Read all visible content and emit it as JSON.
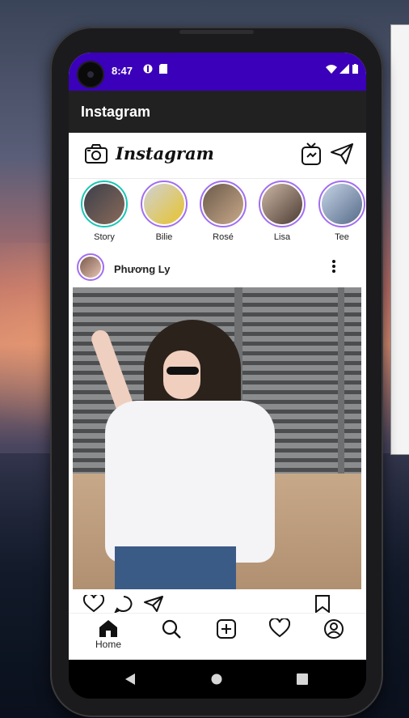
{
  "status_bar": {
    "time": "8:47"
  },
  "app_bar": {
    "title": "Instagram"
  },
  "ig_header": {
    "logo": "Instagram"
  },
  "stories": [
    {
      "label": "Story",
      "own": true,
      "color_a": "#3b3f4a",
      "color_b": "#8a6a5a"
    },
    {
      "label": "Bilie",
      "own": false,
      "color_a": "#cfd2d6",
      "color_b": "#e7c32c"
    },
    {
      "label": "Rosé",
      "own": false,
      "color_a": "#6b5a4a",
      "color_b": "#c9a98a"
    },
    {
      "label": "Lisa",
      "own": false,
      "color_a": "#cdb7a5",
      "color_b": "#4b3b33"
    },
    {
      "label": "Tee",
      "own": false,
      "color_a": "#c6d4e6",
      "color_b": "#556a88"
    }
  ],
  "post": {
    "username": "Phương Ly"
  },
  "bottom_nav": {
    "home_label": "Home"
  },
  "colors": {
    "status_bar": "#3b00b9",
    "app_bar": "#212121",
    "story_ring": "#a26ef0",
    "own_story_ring": "#19c6b5"
  }
}
